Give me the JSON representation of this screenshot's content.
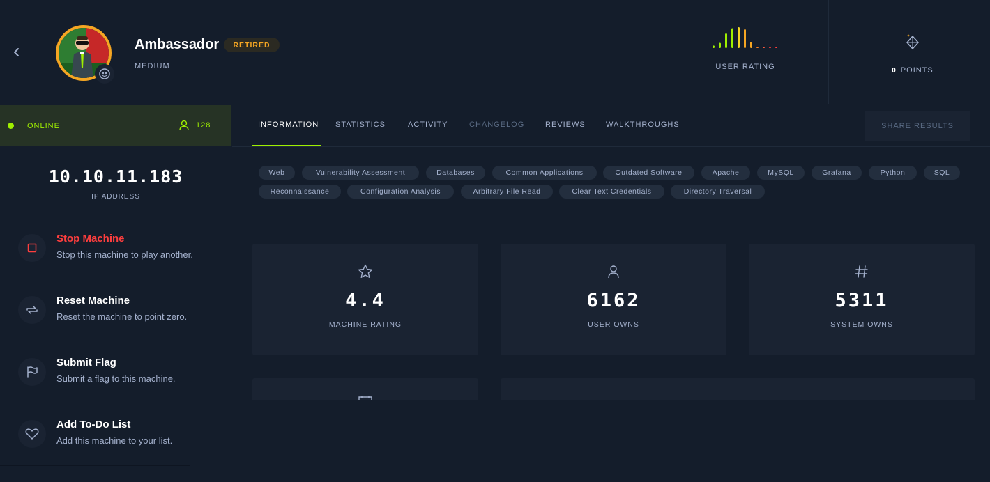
{
  "header": {
    "machine_name": "Ambassador",
    "status_badge": "RETIRED",
    "difficulty": "MEDIUM",
    "user_rating_label": "USER RATING",
    "points_value": "0",
    "points_label": "POINTS",
    "user_rating_bars": [
      {
        "height_fraction": 0.12,
        "color": "#9fef00"
      },
      {
        "height_fraction": 0.25,
        "color": "#9fef00"
      },
      {
        "height_fraction": 0.7,
        "color": "#9fef00"
      },
      {
        "height_fraction": 0.95,
        "color": "#9fef00"
      },
      {
        "height_fraction": 1.0,
        "color": "#f5d523"
      },
      {
        "height_fraction": 0.9,
        "color": "#f5a623"
      },
      {
        "height_fraction": 0.3,
        "color": "#f5a623"
      },
      {
        "height_fraction": 0.06,
        "color": "#f57c23"
      },
      {
        "height_fraction": 0.06,
        "color": "#ff5c3e"
      },
      {
        "height_fraction": 0.06,
        "color": "#ff3e3e"
      },
      {
        "height_fraction": 0.06,
        "color": "#ff3e3e"
      }
    ]
  },
  "sidebar": {
    "status": "ONLINE",
    "player_count": "128",
    "ip_address": "10.10.11.183",
    "ip_label": "IP ADDRESS",
    "actions": [
      {
        "title": "Stop Machine",
        "desc": "Stop this machine to play another.",
        "icon": "stop-square-icon",
        "color": "#ff3e3e"
      },
      {
        "title": "Reset Machine",
        "desc": "Reset the machine to point zero.",
        "icon": "reset-arrows-icon"
      },
      {
        "title": "Submit Flag",
        "desc": "Submit a flag to this machine.",
        "icon": "flag-icon"
      },
      {
        "title": "Add To-Do List",
        "desc": "Add this machine to your list.",
        "icon": "heart-icon"
      }
    ]
  },
  "tabs": [
    {
      "label": "INFORMATION",
      "state": "active"
    },
    {
      "label": "STATISTICS",
      "state": "normal"
    },
    {
      "label": "ACTIVITY",
      "state": "normal"
    },
    {
      "label": "CHANGELOG",
      "state": "disabled"
    },
    {
      "label": "REVIEWS",
      "state": "normal"
    },
    {
      "label": "WALKTHROUGHS",
      "state": "normal"
    }
  ],
  "share_button": "SHARE RESULTS",
  "tags": [
    "Web",
    "Vulnerability Assessment",
    "Databases",
    "Common Applications",
    "Outdated Software",
    "Apache",
    "MySQL",
    "Grafana",
    "Python",
    "SQL",
    "Reconnaissance",
    "Configuration Analysis",
    "Arbitrary File Read",
    "Clear Text Credentials",
    "Directory Traversal"
  ],
  "stats": [
    {
      "value": "4.4",
      "label": "MACHINE RATING",
      "icon": "star-icon"
    },
    {
      "value": "6162",
      "label": "USER OWNS",
      "icon": "user-icon"
    },
    {
      "value": "5311",
      "label": "SYSTEM OWNS",
      "icon": "hash-icon"
    }
  ],
  "colors": {
    "accent": "#9fef00",
    "retired": "#f5a623",
    "danger": "#ff3e3e",
    "background": "#141d2b",
    "card": "#1a2332"
  }
}
